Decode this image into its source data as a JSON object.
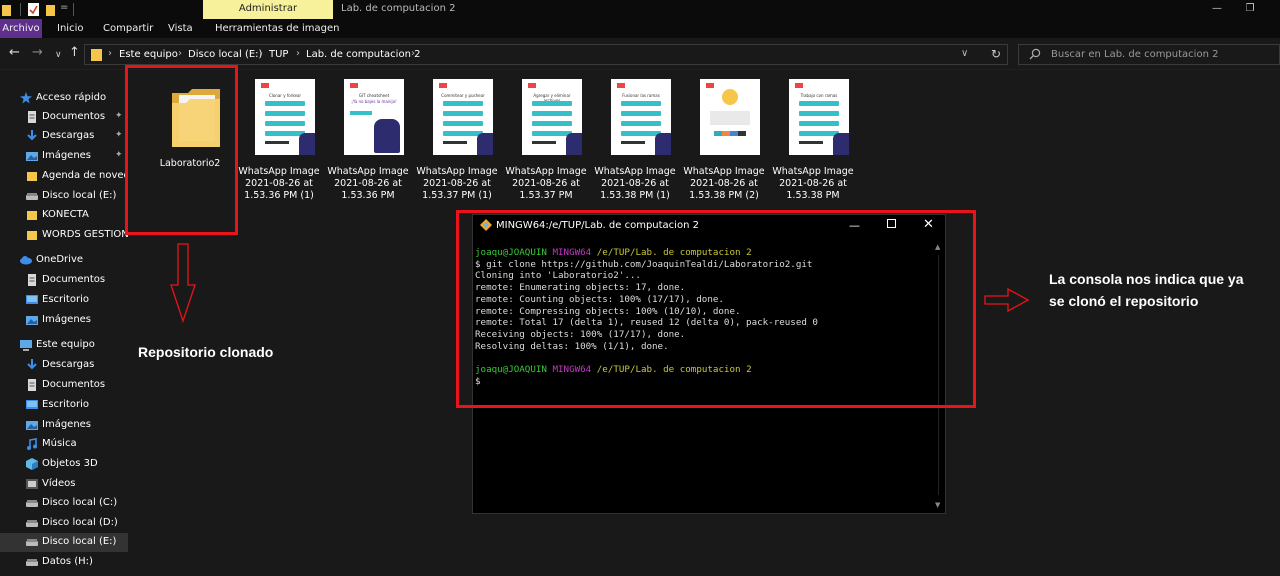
{
  "titlebar": {
    "manage_tab": "Administrar",
    "window_title": "Lab. de computacion 2",
    "quick_access_more": "=",
    "minimize": "—",
    "maximize": "❐"
  },
  "ribbon": {
    "tabs": [
      "Archivo",
      "Inicio",
      "Compartir",
      "Vista",
      "Herramientas de imagen"
    ]
  },
  "nav": {
    "back": "←",
    "forward": "→",
    "history": "∨",
    "up": "↑",
    "refresh": "↻",
    "dropdown": "∨",
    "breadcrumb": [
      "Este equipo",
      "Disco local (E:)",
      "TUP",
      "Lab. de computacion 2"
    ],
    "separator": "›",
    "search_placeholder": "Buscar en Lab. de computacion 2"
  },
  "sidebar": {
    "pin": "✦",
    "items": [
      {
        "label": "Acceso rápido",
        "icon": "star-icon"
      },
      {
        "label": "Documentos",
        "icon": "documents-icon",
        "pinned": true
      },
      {
        "label": "Descargas",
        "icon": "downloads-icon",
        "pinned": true
      },
      {
        "label": "Imágenes",
        "icon": "pictures-icon",
        "pinned": true
      },
      {
        "label": "Agenda de novedades",
        "icon": "folder-icon"
      },
      {
        "label": "Disco local (E:)",
        "icon": "drive-icon"
      },
      {
        "label": "KONECTA",
        "icon": "folder-icon"
      },
      {
        "label": "WORDS GESTION",
        "icon": "folder-icon"
      },
      {
        "label": "OneDrive",
        "icon": "cloud-icon"
      },
      {
        "label": "Documentos",
        "icon": "documents-icon"
      },
      {
        "label": "Escritorio",
        "icon": "desktop-icon"
      },
      {
        "label": "Imágenes",
        "icon": "pictures-icon"
      },
      {
        "label": "Este equipo",
        "icon": "computer-icon"
      },
      {
        "label": "Descargas",
        "icon": "downloads-icon"
      },
      {
        "label": "Documentos",
        "icon": "documents-icon"
      },
      {
        "label": "Escritorio",
        "icon": "desktop-icon"
      },
      {
        "label": "Imágenes",
        "icon": "pictures-icon"
      },
      {
        "label": "Música",
        "icon": "music-icon"
      },
      {
        "label": "Objetos 3D",
        "icon": "3d-objects-icon"
      },
      {
        "label": "Vídeos",
        "icon": "videos-icon"
      },
      {
        "label": "Disco local (C:)",
        "icon": "drive-icon"
      },
      {
        "label": "Disco local (D:)",
        "icon": "drive-icon"
      },
      {
        "label": "Disco local (E:)",
        "icon": "drive-icon",
        "selected": true
      },
      {
        "label": "Datos (H:)",
        "icon": "drive-icon"
      }
    ]
  },
  "files": [
    {
      "name": "Laboratorio2",
      "type": "folder"
    },
    {
      "name": "WhatsApp Image 2021-08-26 at 1.53.36 PM (1)",
      "type": "image",
      "thumb_title": "Clonar y forkear"
    },
    {
      "name": "WhatsApp Image 2021-08-26 at 1.53.36 PM",
      "type": "image",
      "thumb_title": "GIT cheatsheet",
      "thumb_subtitle": "¡Ya no bajes la manija!"
    },
    {
      "name": "WhatsApp Image 2021-08-26 at 1.53.37 PM (1)",
      "type": "image",
      "thumb_title": "Commitear y pushear"
    },
    {
      "name": "WhatsApp Image 2021-08-26 at 1.53.37 PM",
      "type": "image",
      "thumb_title": "Agregar y eliminar archivos"
    },
    {
      "name": "WhatsApp Image 2021-08-26 at 1.53.38 PM (1)",
      "type": "image",
      "thumb_title": "Fusionar las ramas"
    },
    {
      "name": "WhatsApp Image 2021-08-26 at 1.53.38 PM (2)",
      "type": "image",
      "thumb_title": ""
    },
    {
      "name": "WhatsApp Image 2021-08-26 at 1.53.38 PM",
      "type": "image",
      "thumb_title": "Trabajo con ramas"
    }
  ],
  "terminal": {
    "title": "MINGW64:/e/TUP/Lab. de computacion 2",
    "min": "—",
    "close": "✕",
    "scroll_up": "▲",
    "scroll_down": "▼",
    "prompt_user": "joaqu@JOAQUIN",
    "prompt_env": "MINGW64",
    "prompt_path": "/e/TUP/Lab. de computacion 2",
    "lines": [
      "$ git clone https://github.com/JoaquinTealdi/Laboratorio2.git",
      "Cloning into 'Laboratorio2'...",
      "remote: Enumerating objects: 17, done.",
      "remote: Counting objects: 100% (17/17), done.",
      "remote: Compressing objects: 100% (10/10), done.",
      "remote: Total 17 (delta 1), reused 12 (delta 0), pack-reused 0",
      "Receiving objects: 100% (17/17), done.",
      "Resolving deltas: 100% (1/1), done."
    ],
    "cursor_line": "$"
  },
  "annotations": {
    "repo": "Repositorio clonado",
    "console": "La consola nos indica que ya se clonó el repositorio",
    "color": "#e8141a"
  },
  "colors": {
    "archivo_tab": "#5f2f8d",
    "manage_tab": "#f8f19b",
    "folder": "#f5c64a",
    "prompt_user": "#38c838",
    "prompt_env": "#c03bc0",
    "prompt_path": "#c8c83a"
  }
}
